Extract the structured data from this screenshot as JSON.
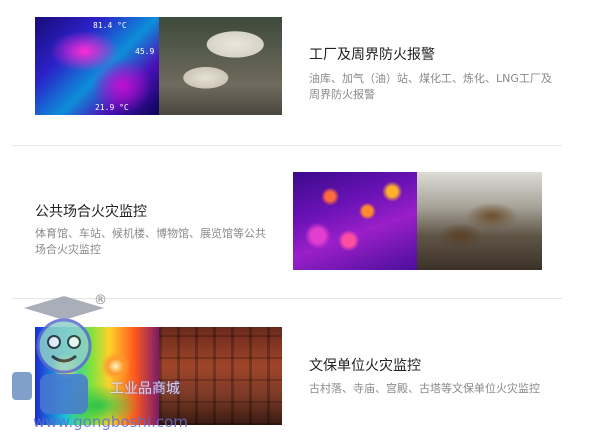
{
  "sections": [
    {
      "title": "工厂及周界防火报警",
      "description": "油库、加气（油）站、煤化工、炼化、LNG工厂及周界防火报警",
      "thumb_labels": [
        "81.4 °C",
        "45.9",
        "21.9 °C"
      ]
    },
    {
      "title": "公共场合火灾监控",
      "description": "体育馆、车站、候机楼、博物馆、展览馆等公共场合火灾监控",
      "thumb_labels": []
    },
    {
      "title": "文保单位火灾监控",
      "description": "古村落、寺庙、宫殿、古塔等文保单位火灾监控",
      "thumb_labels": []
    }
  ],
  "watermark": {
    "registered_mark": "®",
    "brand_text": "工业品商城",
    "url": "www.gongboshi.com"
  },
  "colors": {
    "title": "#222222",
    "description": "#8a8a8a",
    "divider": "#e6e6e6",
    "watermark": "#5a6bd6"
  }
}
